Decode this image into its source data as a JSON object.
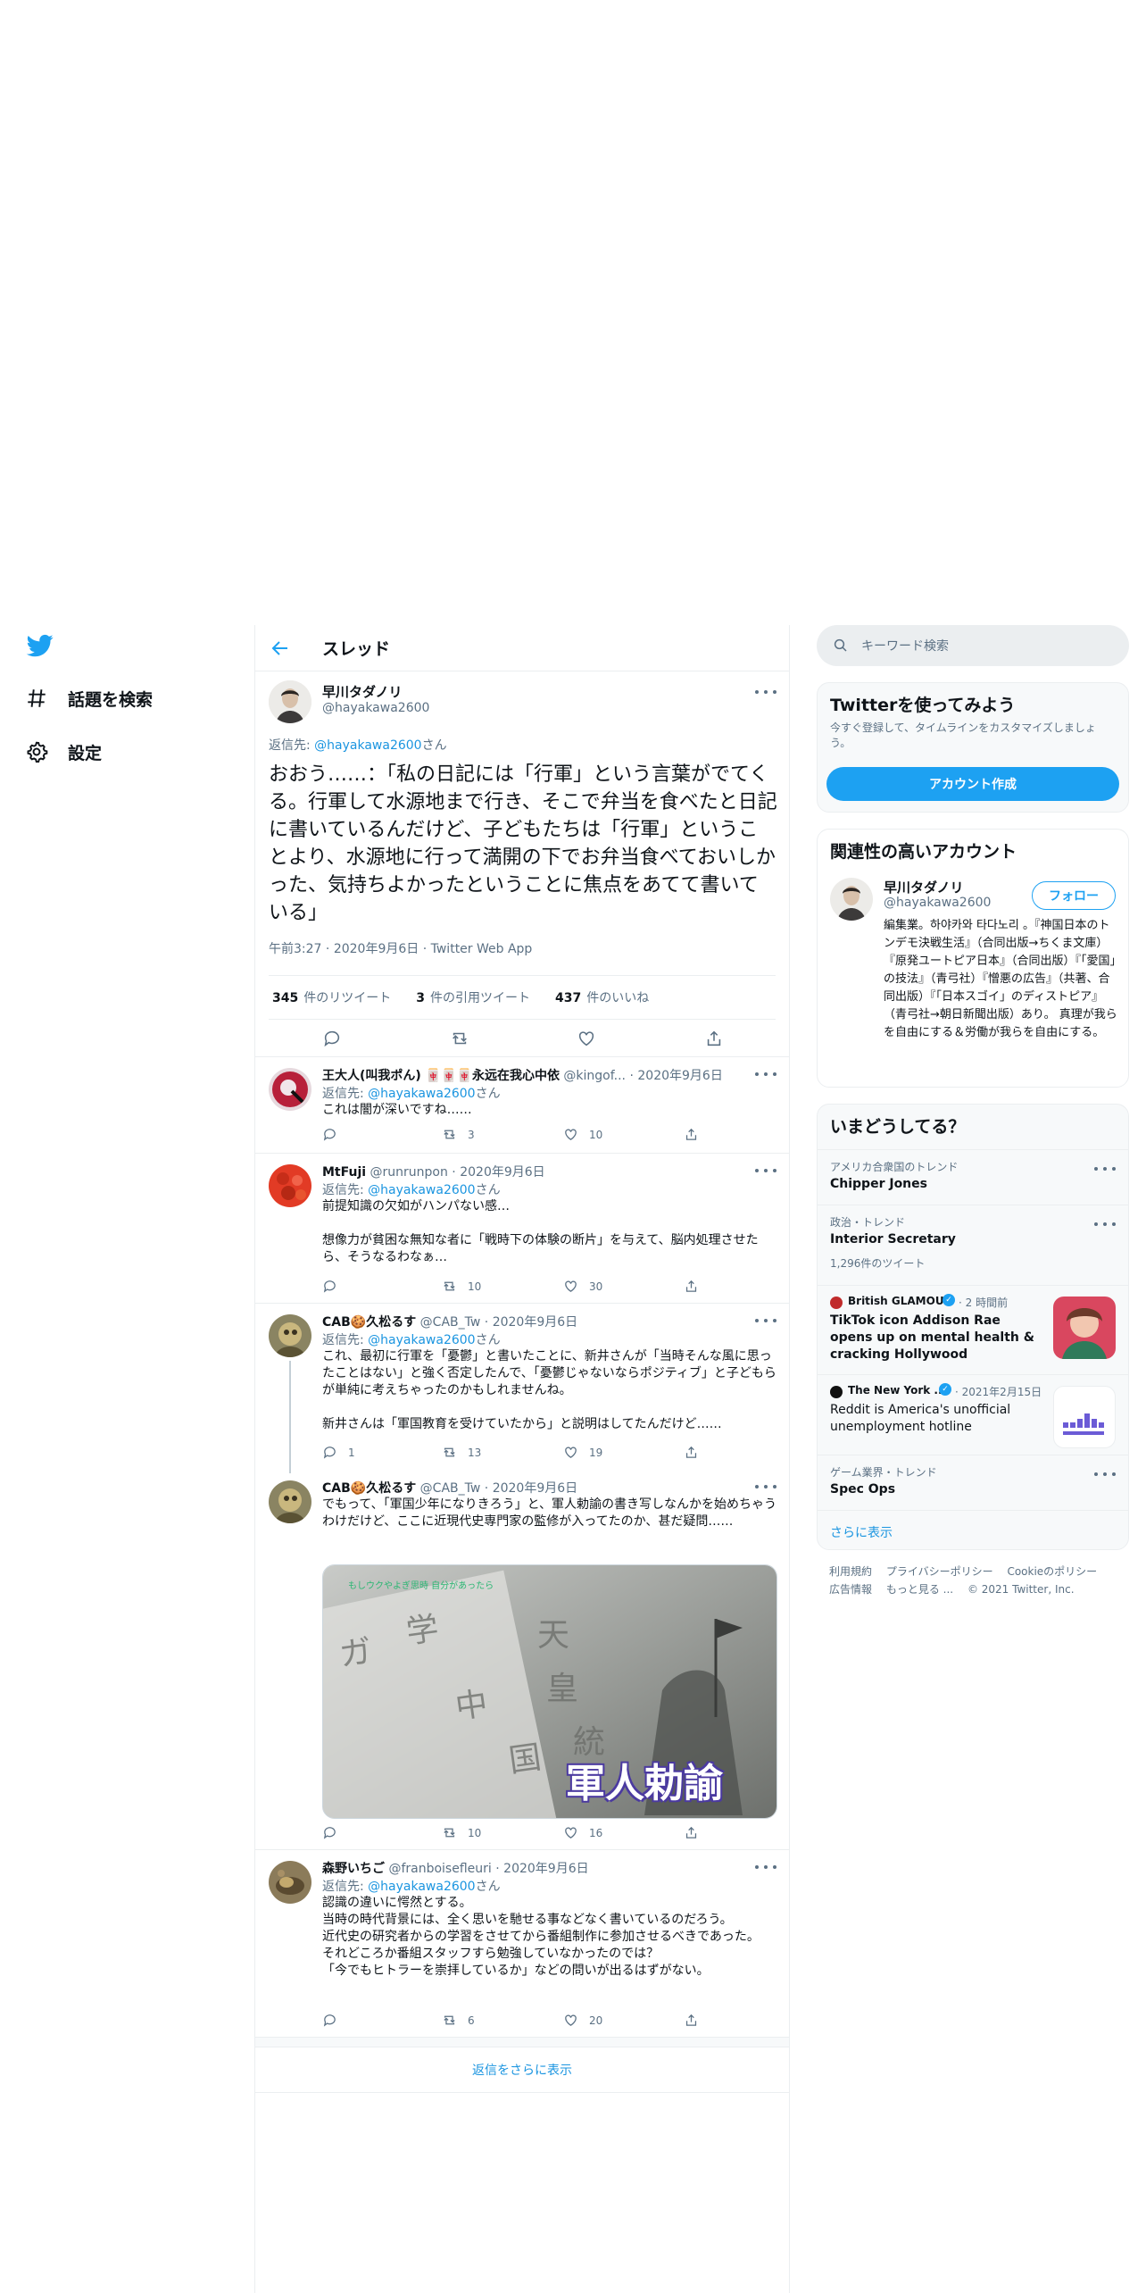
{
  "nav": {
    "explore": "話題を検索",
    "settings": "設定"
  },
  "header": {
    "title": "スレッド"
  },
  "main_tweet": {
    "name": "早川タダノリ",
    "handle": "@hayakawa2600",
    "reply_prefix": "返信先: ",
    "reply_to": "@hayakawa2600",
    "reply_suffix": "さん",
    "text": "おおう……：「私の日記には「行軍」という言葉がでてくる。行軍して水源地まで行き、そこで弁当を食べたと日記に書いているんだけど、子どもたちは「行軍」ということより、水源地に行って満開の下でお弁当食べておいしかった、気持ちよかったということに焦点をあてて書いている」",
    "time": "午前3:27",
    "date": "2020年9月6日",
    "client": "Twitter Web App",
    "retweets_count": "345",
    "retweets_label": "件のリツイート",
    "quotes_count": "3",
    "quotes_label": "件の引用ツイート",
    "likes_count": "437",
    "likes_label": "件のいいね"
  },
  "replies": [
    {
      "name": "王大人(叫我ポん) 🀄🀄🀄永远在我心中依",
      "handle": "@kingof...",
      "date": "2020年9月6日",
      "reply_to": "@hayakawa2600",
      "text": "これは闇が深いですね……",
      "replies": "",
      "retweets": "3",
      "likes": "10"
    },
    {
      "name": "MtFuji",
      "handle": "@runrunpon",
      "date": "2020年9月6日",
      "reply_to": "@hayakawa2600",
      "text": "前提知識の欠如がハンパない感…\n\n想像力が貧困な無知な者に「戦時下の体験の断片」を与えて、脳内処理させたら、そうなるわなぁ…",
      "replies": "",
      "retweets": "10",
      "likes": "30"
    },
    {
      "name": "CAB🍪久松るす",
      "handle": "@CAB_Tw",
      "date": "2020年9月6日",
      "reply_to": "@hayakawa2600",
      "text": "これ、最初に行軍を「憂鬱」と書いたことに、新井さんが「当時そんな風に思ったことはない」と強く否定したんで、「憂鬱じゃないならポジティブ」と子どもらが単純に考えちゃったのかもしれませんね。\n\n新井さんは「軍国教育を受けていたから」と説明はしてたんだけど……",
      "replies": "1",
      "retweets": "13",
      "likes": "19"
    },
    {
      "name": "CAB🍪久松るす",
      "handle": "@CAB_Tw",
      "date": "2020年9月6日",
      "text": "でもって、「軍国少年になりきろう」と、軍人勅諭の書き写しなんかを始めちゃうわけだけど、ここに近現代史専門家の監修が入ってたのか、甚だ疑問……",
      "media_caption": "軍人勅諭",
      "media_subtitle": "もしウクやよぎ思時 自分があったら",
      "replies": "",
      "retweets": "10",
      "likes": "16"
    },
    {
      "name": "森野いちご",
      "handle": "@franboisefleuri",
      "date": "2020年9月6日",
      "reply_to": "@hayakawa2600",
      "text": "認識の違いに愕然とする。\n当時の時代背景には、全く思いを馳せる事などなく書いているのだろう。\n近代史の研究者からの学習をさせてから番組制作に参加させるべきであった。\nそれどころか番組スタッフすら勉強していなかったのでは？\n「今でもヒトラーを崇拝しているか」などの問いが出るはずがない。",
      "replies": "",
      "retweets": "6",
      "likes": "20"
    }
  ],
  "show_more": "返信をさらに表示",
  "sidebar": {
    "search_placeholder": "キーワード検索",
    "signup": {
      "title": "Twitterを使ってみよう",
      "desc": "今すぐ登録して、タイムラインをカスタマイズしましょう。",
      "button": "アカウント作成"
    },
    "relevant": {
      "title": "関連性の高いアカウント",
      "name": "早川タダノリ",
      "handle": "@hayakawa2600",
      "follow": "フォロー",
      "bio": "編集業。하야카와 타다노리 。『神国日本のトンデモ決戦生活』（合同出版→ちくま文庫）『原発ユートピア日本』（合同出版）『「愛国」の技法』（青弓社）『憎悪の広告』（共著、合同出版）『「日本スゴイ」のディストピア』（青弓社→朝日新聞出版）あり。 真理が我らを自由にする＆労働が我らを自由にする。"
    },
    "trends": {
      "title": "いまどうしてる？",
      "items": [
        {
          "context": "アメリカ合衆国のトレンド",
          "title": "Chipper Jones",
          "count": ""
        },
        {
          "context": "政治・トレンド",
          "title": "Interior Secretary",
          "count": "1,296件のツイート"
        }
      ],
      "news": [
        {
          "source": "British GLAMOUR",
          "time": "2 時間前",
          "title": "TikTok icon Addison Rae opens up on mental health & cracking Hollywood"
        },
        {
          "source": "The New York ...",
          "time": "2021年2月15日",
          "title": "Reddit is America's unofficial unemployment hotline"
        }
      ],
      "last": {
        "context": "ゲーム業界・トレンド",
        "title": "Spec Ops"
      },
      "show_more": "さらに表示"
    },
    "footer": {
      "terms": "利用規約",
      "privacy": "プライバシーポリシー",
      "cookie": "Cookieのポリシー",
      "ads": "広告情報",
      "more": "もっと見る ...",
      "copyright": "© 2021 Twitter, Inc."
    }
  },
  "colors": {
    "accent": "#1da1f2",
    "link": "#1b95e0",
    "muted": "#5b7083"
  }
}
